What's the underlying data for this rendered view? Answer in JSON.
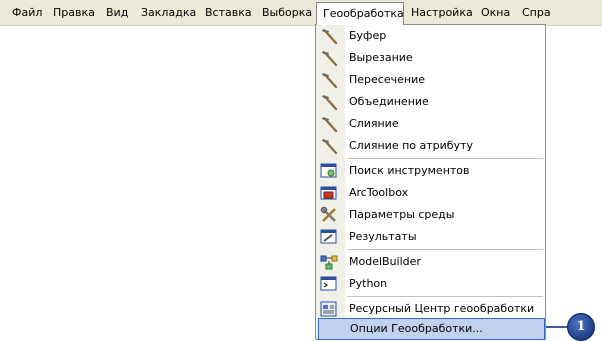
{
  "menubar": {
    "items": [
      {
        "label": "Файл"
      },
      {
        "label": "Правка"
      },
      {
        "label": "Вид"
      },
      {
        "label": "Закладка"
      },
      {
        "label": "Вставка"
      },
      {
        "label": "Выборка"
      },
      {
        "label": "Геообработка"
      },
      {
        "label": "Настройка"
      },
      {
        "label": "Окна"
      },
      {
        "label": "Спра"
      }
    ]
  },
  "menu": {
    "items": [
      {
        "label": "Буфер",
        "icon": "hammer-icon"
      },
      {
        "label": "Вырезание",
        "icon": "hammer-icon"
      },
      {
        "label": "Пересечение",
        "icon": "hammer-icon"
      },
      {
        "label": "Объединение",
        "icon": "hammer-icon"
      },
      {
        "label": "Слияние",
        "icon": "hammer-icon"
      },
      {
        "label": "Слияние по атрибуту",
        "icon": "hammer-icon"
      },
      {
        "label": "Поиск инструментов",
        "icon": "search-window-icon"
      },
      {
        "label": "ArcToolbox",
        "icon": "toolbox-icon"
      },
      {
        "label": "Параметры среды",
        "icon": "tools-icon"
      },
      {
        "label": "Результаты",
        "icon": "results-window-icon"
      },
      {
        "label": "ModelBuilder",
        "icon": "model-icon"
      },
      {
        "label": "Python",
        "icon": "python-window-icon"
      },
      {
        "label": "Ресурсный Центр геообработки",
        "icon": "resource-center-icon"
      },
      {
        "label": "Опции Геообработки...",
        "icon": ""
      }
    ]
  },
  "callout": {
    "label": "1"
  },
  "colors": {
    "highlight": "#c1d2ee",
    "highlight_border": "#316ac5",
    "callout": "#1f3f8a"
  }
}
